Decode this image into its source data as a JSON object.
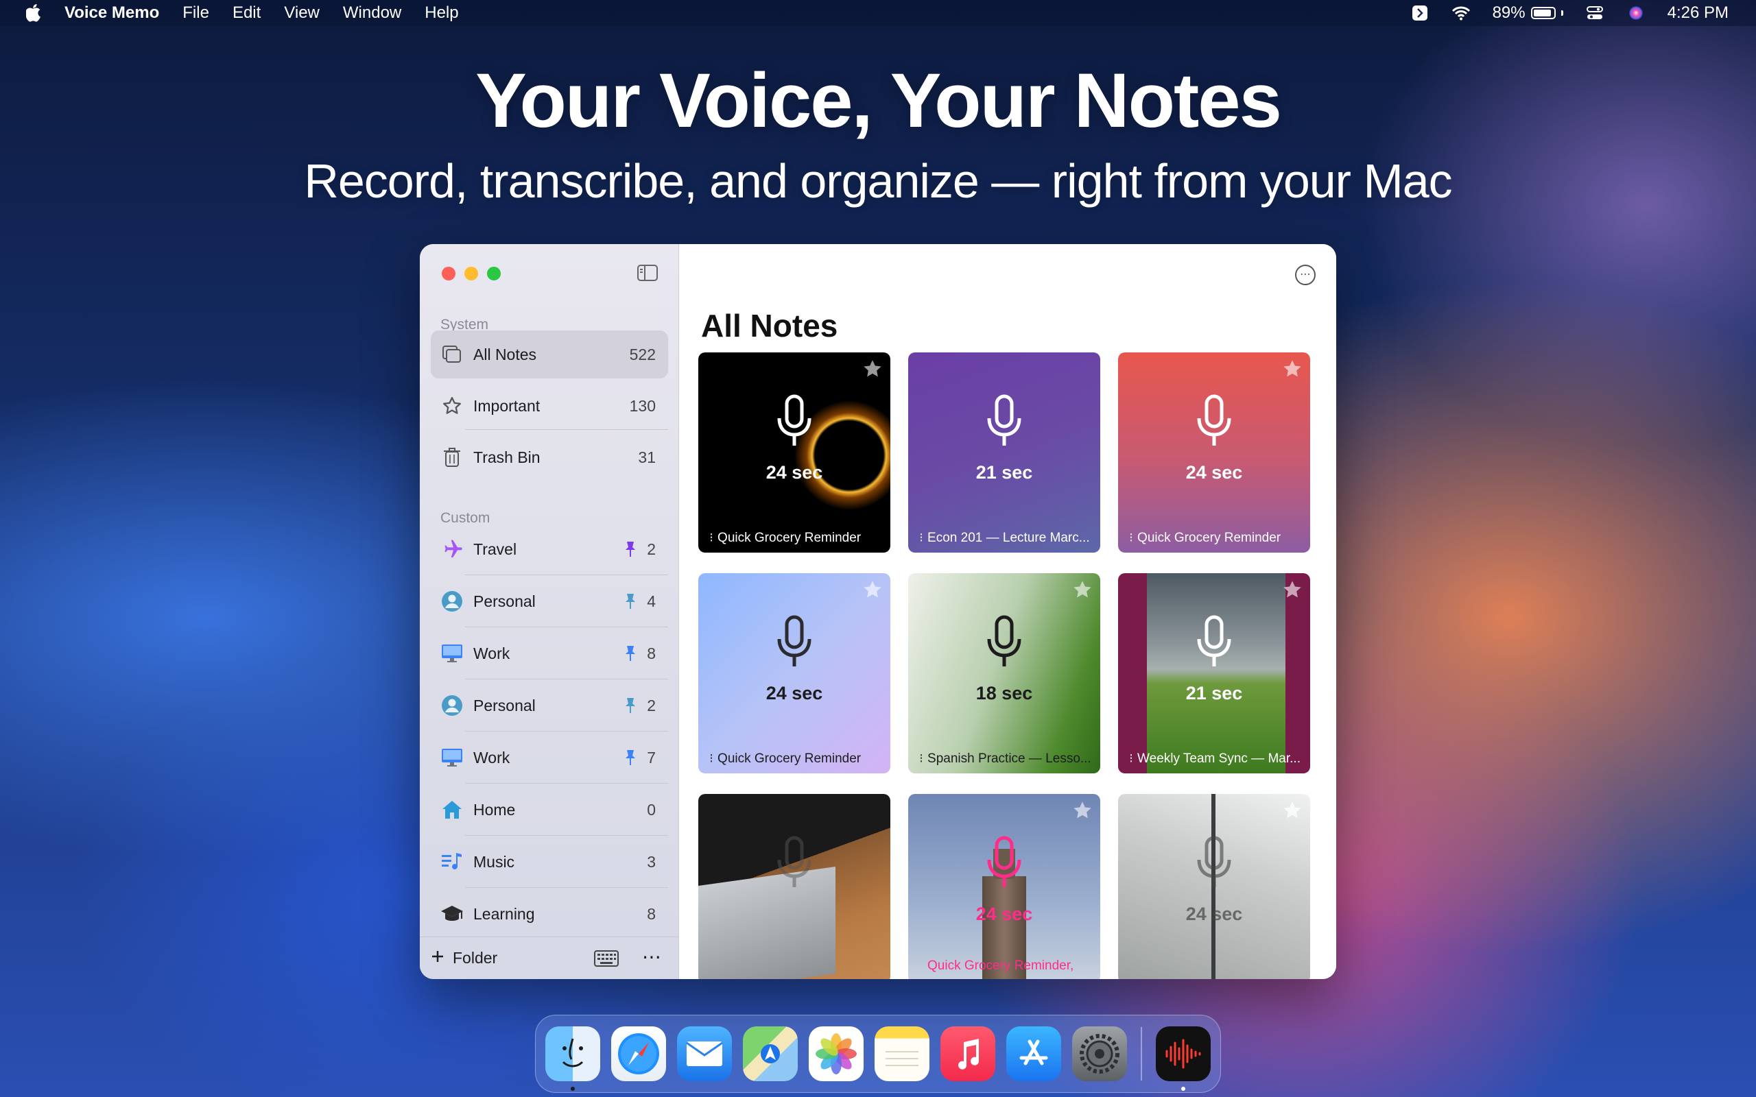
{
  "menubar": {
    "app_name": "Voice Memo",
    "menus": [
      "File",
      "Edit",
      "View",
      "Window",
      "Help"
    ],
    "battery": "89%",
    "battery_level": 0.89,
    "time": "4:26 PM"
  },
  "hero": {
    "title": "Your Voice, Your Notes",
    "subtitle": "Record, transcribe, and organize — right from your Mac"
  },
  "sidebar": {
    "system_label": "System",
    "system_items": [
      {
        "label": "All Notes",
        "count": "522",
        "icon": "notes-stack-icon",
        "selected": true
      },
      {
        "label": "Important",
        "count": "130",
        "icon": "star-outline-icon"
      },
      {
        "label": "Trash Bin",
        "count": "31",
        "icon": "trash-icon"
      }
    ],
    "custom_label": "Custom",
    "custom_items": [
      {
        "label": "Travel",
        "count": "2",
        "icon": "airplane-icon",
        "pinned": true,
        "icon_color": "#a855f7"
      },
      {
        "label": "Personal",
        "count": "4",
        "icon": "person-circle-icon",
        "pinned": true,
        "icon_color": "#4a9bc7"
      },
      {
        "label": "Work",
        "count": "8",
        "icon": "desktop-icon",
        "pinned": true,
        "icon_color": "#3b82f6"
      },
      {
        "label": "Personal",
        "count": "2",
        "icon": "person-circle-icon",
        "pinned": true,
        "icon_color": "#4a9bc7"
      },
      {
        "label": "Work",
        "count": "7",
        "icon": "desktop-icon",
        "pinned": true,
        "icon_color": "#3b82f6"
      },
      {
        "label": "Home",
        "count": "0",
        "icon": "house-icon",
        "pinned": false,
        "icon_color": "#2a9bd8"
      },
      {
        "label": "Music",
        "count": "3",
        "icon": "music-list-icon",
        "pinned": false,
        "icon_color": "#3b82f6"
      },
      {
        "label": "Learning",
        "count": "8",
        "icon": "graduation-cap-icon",
        "pinned": false,
        "icon_color": "#2c2c2e"
      }
    ],
    "add_folder_label": "Folder"
  },
  "main": {
    "title": "All Notes",
    "cards": [
      {
        "duration": "24 sec",
        "caption": "Quick Grocery Reminder",
        "starred": true,
        "bg": "eclipse"
      },
      {
        "duration": "21 sec",
        "caption": "Econ 201 — Lecture Marc...",
        "starred": false,
        "bg": "purple"
      },
      {
        "duration": "24 sec",
        "caption": "Quick Grocery Reminder",
        "starred": true,
        "bg": "coral"
      },
      {
        "duration": "24 sec",
        "caption": "Quick Grocery Reminder",
        "starred": true,
        "bg": "lavender"
      },
      {
        "duration": "18 sec",
        "caption": "Spanish Practice — Lesso...",
        "starred": true,
        "bg": "green"
      },
      {
        "duration": "21 sec",
        "caption": "Weekly Team Sync — Mar...",
        "starred": true,
        "bg": "field"
      },
      {
        "duration": "",
        "caption": "",
        "starred": false,
        "bg": "laptop"
      },
      {
        "duration": "24 sec",
        "caption": "Quick Grocery Reminder,",
        "starred": true,
        "bg": "building"
      },
      {
        "duration": "24 sec",
        "caption": "",
        "starred": true,
        "bg": "sail"
      }
    ]
  },
  "dock": {
    "apps": [
      "finder-icon",
      "safari-icon",
      "mail-icon",
      "maps-icon",
      "photos-icon",
      "notes-icon",
      "music-icon",
      "app-store-icon",
      "settings-icon",
      "voice-memo-icon"
    ]
  }
}
